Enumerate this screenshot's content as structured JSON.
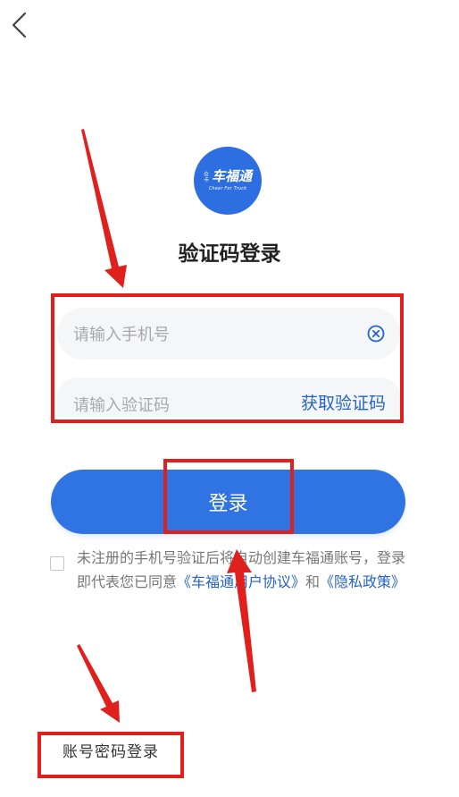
{
  "header": {
    "back_icon": "chevron-left-icon"
  },
  "logo": {
    "brand_small": "众卡",
    "brand": "车福通",
    "slogan": "Cheer For Truck",
    "color": "#2d6fe0"
  },
  "title": "验证码登录",
  "form": {
    "phone_placeholder": "请输入手机号",
    "clear_icon": "clear-circle-icon",
    "code_placeholder": "请输入验证码",
    "get_code_label": "获取验证码"
  },
  "login_button": {
    "label": "登录",
    "color": "#3074e3"
  },
  "agreement": {
    "text_before": "未注册的手机号验证后将自动创建车福通账号，登录即代表您已同意",
    "user_agreement": "《车福通用户协议》",
    "and": "和",
    "privacy_policy": "《隐私政策》"
  },
  "password_login_label": "账号密码登录",
  "colors": {
    "accent": "#2563c9",
    "annotation": "#e0201c"
  }
}
